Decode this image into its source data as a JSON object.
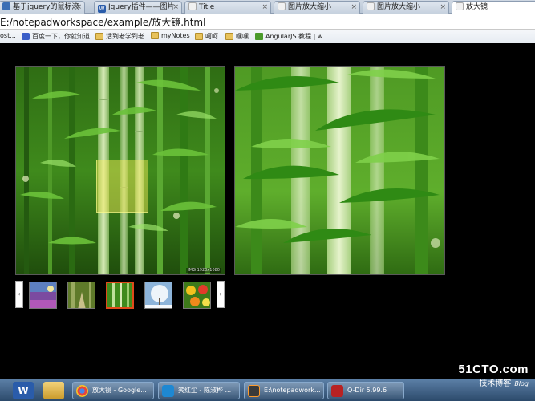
{
  "browser": {
    "tabs": [
      {
        "label": "基于jquery的鼠标滚",
        "icon": "document-icon",
        "active": false
      },
      {
        "label": "Jquery插件——图片",
        "icon": "word-icon",
        "active": false
      },
      {
        "label": "Title",
        "icon": "blank-page-icon",
        "active": false
      },
      {
        "label": "图片放大缩小",
        "icon": "blank-page-icon",
        "active": false
      },
      {
        "label": "图片放大缩小",
        "icon": "blank-page-icon",
        "active": false
      },
      {
        "label": "放大镜",
        "icon": "blank-page-icon",
        "active": true
      }
    ],
    "tab_close_glyph": "×",
    "address": "E:/notepadworkspace/example/放大镜.html",
    "bookmarks": [
      {
        "label": "ost...",
        "icon": ""
      },
      {
        "label": "百度一下，你就知道",
        "icon": "baidu-icon"
      },
      {
        "label": "活到老学到老",
        "icon": "folder-icon"
      },
      {
        "label": "myNotes",
        "icon": "folder-icon"
      },
      {
        "label": "呵呵",
        "icon": "folder-icon"
      },
      {
        "label": "嘿嘿",
        "icon": "folder-icon"
      },
      {
        "label": "AngularJS 教程 | w...",
        "icon": "angular-site-icon"
      }
    ]
  },
  "page": {
    "main_image_caption": "IMG 1920x1080",
    "prev_arrow": "‹",
    "next_arrow": "›",
    "thumbnails": [
      {
        "subject": "lavender-field",
        "selected": false
      },
      {
        "subject": "forest-path",
        "selected": false
      },
      {
        "subject": "bamboo",
        "selected": true
      },
      {
        "subject": "snowy-tree",
        "selected": false
      },
      {
        "subject": "flowers",
        "selected": false
      }
    ],
    "lens_color": "#fff05a"
  },
  "taskbar": {
    "pinned": [
      {
        "icon": "word-icon"
      },
      {
        "icon": "explorer-icon"
      }
    ],
    "tasks": [
      {
        "label": "放大镜 - Google...",
        "icon": "chrome-icon"
      },
      {
        "label": "笑红尘 - 陈淑桦 ...",
        "icon": "music-icon"
      },
      {
        "label": "E:\\notepadwork...",
        "icon": "sublime-icon"
      },
      {
        "label": "Q-Dir 5.99.6",
        "icon": "qdir-icon"
      }
    ]
  },
  "watermark": {
    "site": "51CTO.com",
    "tagline": "技术博客",
    "blog": "Blog"
  },
  "colors": {
    "accent_selected": "#e04a1a",
    "bamboo_green": "#3f8a1c",
    "taskbar": "#2c4a6b"
  }
}
